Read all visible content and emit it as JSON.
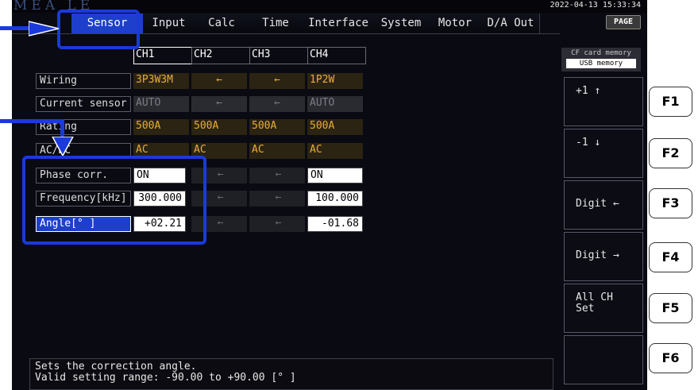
{
  "header": {
    "mode_ghost": "MEA     LE",
    "datetime": "2022-04-13 15:33:34",
    "page_label": "PAGE"
  },
  "tabs": [
    {
      "label": "Sensor",
      "active": true
    },
    {
      "label": "Input"
    },
    {
      "label": "Calc"
    },
    {
      "label": "Time"
    },
    {
      "label": "Interface"
    },
    {
      "label": "System"
    },
    {
      "label": "Motor"
    },
    {
      "label": "D/A Out"
    }
  ],
  "storage": {
    "line1": "CF card memory",
    "line2": "USB  memory"
  },
  "channels": [
    "CH1",
    "CH2",
    "CH3",
    "CH4"
  ],
  "rows": {
    "wiring": {
      "label": "Wiring",
      "ch1": "3P3W3M",
      "ch2": "←",
      "ch3": "←",
      "ch4": "1P2W"
    },
    "current_sensor": {
      "label": "Current sensor",
      "ch1": "AUTO",
      "ch2": "←",
      "ch3": "←",
      "ch4": "AUTO"
    },
    "rating": {
      "label": "Rating",
      "ch1": "500A",
      "ch2": "500A",
      "ch3": "500A",
      "ch4": "500A"
    },
    "ac_dc": {
      "label": "AC/DC",
      "ch1": "AC",
      "ch2": "AC",
      "ch3": "AC",
      "ch4": "AC"
    },
    "phase_corr": {
      "label": "Phase corr.",
      "ch1": "ON",
      "ch2": "←",
      "ch3": "←",
      "ch4": "ON"
    },
    "frequency": {
      "label": "Frequency[kHz]",
      "ch1": "300.000",
      "ch2": "←",
      "ch3": "←",
      "ch4": "100.000"
    },
    "angle": {
      "label": "Angle[° ]",
      "ch1": "+02.21",
      "ch2": "←",
      "ch3": "←",
      "ch4": "-01.68"
    }
  },
  "fkeys": [
    {
      "label": "+1 ↑"
    },
    {
      "label": "-1 ↓"
    },
    {
      "label": "Digit ←"
    },
    {
      "label": "Digit →"
    },
    {
      "label_1": "All CH",
      "label_2": "Set"
    },
    {
      "label": ""
    }
  ],
  "fbuttons": [
    "F1",
    "F2",
    "F3",
    "F4",
    "F5",
    "F6"
  ],
  "message": {
    "line1": "Sets the correction angle.",
    "line2": "Valid setting range: -90.00 to +90.00 [° ]"
  },
  "colors": {
    "accent": "#1d3fcc",
    "value_orange": "#e8ad38",
    "callout": "#1a3adb"
  }
}
